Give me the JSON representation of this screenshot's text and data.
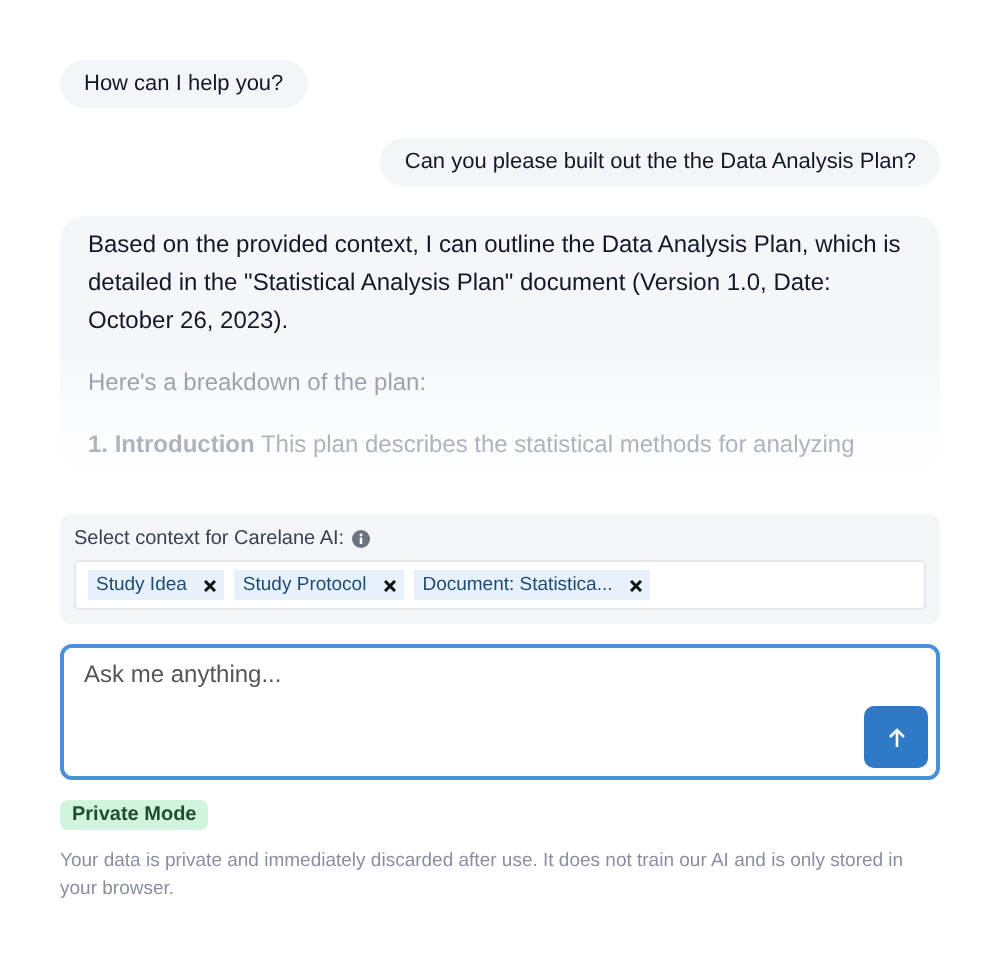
{
  "messages": [
    {
      "kind": "assistant",
      "paragraphs": [
        "How can I help you?"
      ]
    },
    {
      "kind": "user",
      "paragraphs": [
        "Can you please built out the the Data Analysis Plan?"
      ]
    },
    {
      "kind": "assistant",
      "paragraphs": [
        "Based on the provided context, I can outline the Data Analysis Plan, which is detailed in the \"Statistical Analysis Plan\" document (Version 1.0, Date: October 26, 2023).",
        "Here's a breakdown of the plan:",
        "**1. Introduction** This plan describes the statistical methods for analyzing"
      ]
    }
  ],
  "context": {
    "label": "Select context for Carelane AI:",
    "chips": [
      {
        "label": "Study Idea"
      },
      {
        "label": "Study Protocol"
      },
      {
        "label": "Document: Statistica..."
      }
    ]
  },
  "input": {
    "placeholder": "Ask me anything..."
  },
  "mode_badge": "Private Mode",
  "privacy_note": "Your data is private and immediately discarded after use. It does not train our AI and is only stored in your browser."
}
